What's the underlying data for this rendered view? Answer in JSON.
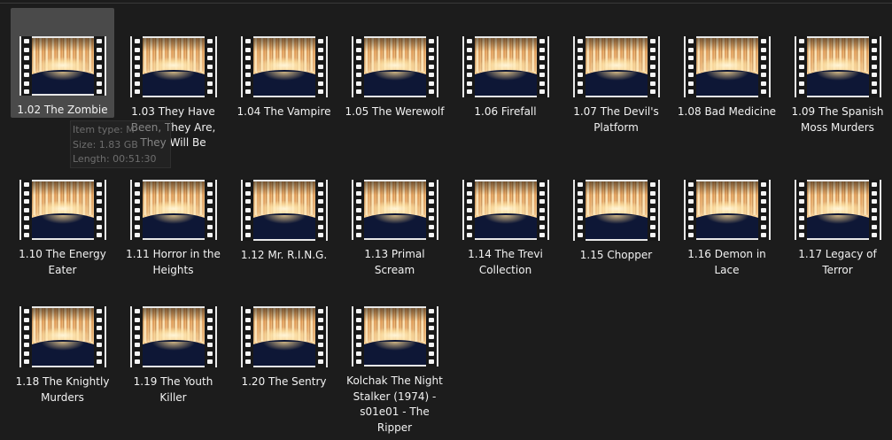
{
  "files": [
    {
      "name": "1.02 The Zombie",
      "selected": true
    },
    {
      "name": "1.03 They Have Been, They Are, They Will Be"
    },
    {
      "name": "1.04 The Vampire"
    },
    {
      "name": "1.05 The Werewolf"
    },
    {
      "name": "1.06 Firefall"
    },
    {
      "name": "1.07 The Devil's Platform"
    },
    {
      "name": "1.08 Bad Medicine"
    },
    {
      "name": "1.09 The Spanish Moss Murders"
    },
    {
      "name": "1.10 The Energy Eater"
    },
    {
      "name": "1.11 Horror in the Heights"
    },
    {
      "name": "1.12 Mr. R.I.N.G."
    },
    {
      "name": "1.13 Primal Scream"
    },
    {
      "name": "1.14 The Trevi Collection"
    },
    {
      "name": "1.15 Chopper"
    },
    {
      "name": "1.16 Demon in Lace"
    },
    {
      "name": "1.17 Legacy of Terror"
    },
    {
      "name": "1.18 The Knightly Murders"
    },
    {
      "name": "1.19 The Youth Killer"
    },
    {
      "name": "1.20 The Sentry"
    },
    {
      "name": "Kolchak The Night Stalker (1974) - s01e01 - The Ripper"
    }
  ],
  "thumbnail_icon": "video-file-icon",
  "tooltip": {
    "item_type": "Item type: M",
    "size": "Size: 1.83 GB",
    "length": "Length: 00:51:30"
  }
}
